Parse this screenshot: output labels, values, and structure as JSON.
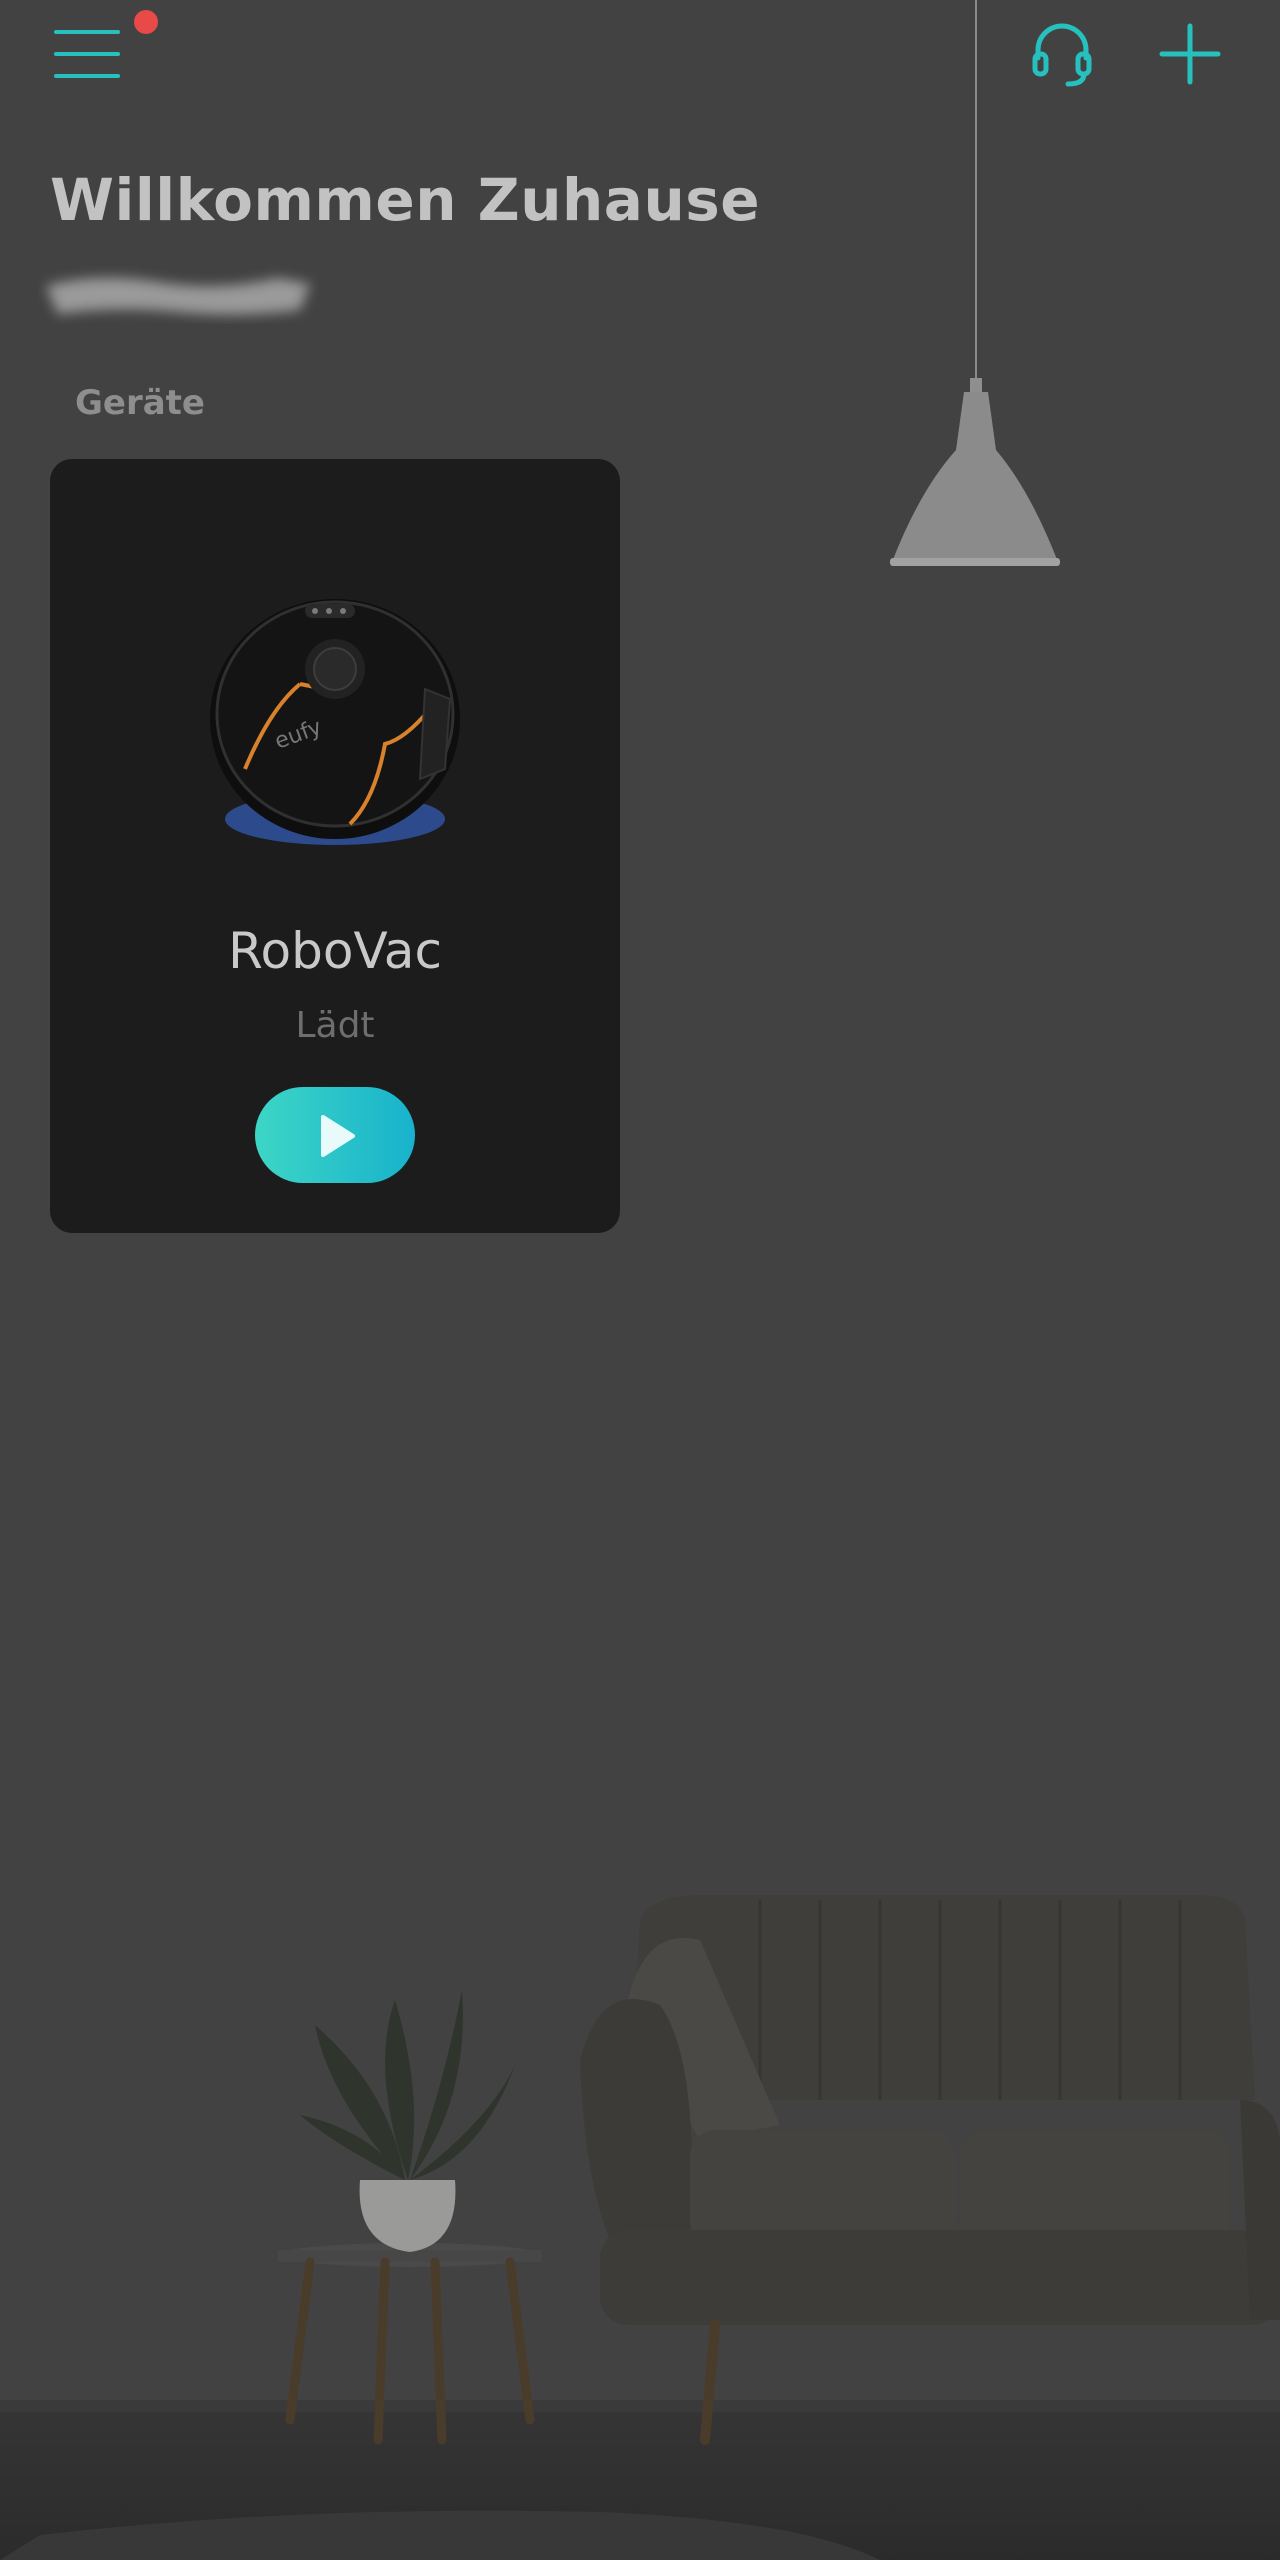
{
  "header": {
    "menu_icon": "hamburger-menu-icon",
    "notification_color": "#e84a4a",
    "support_icon": "headset-icon",
    "add_icon": "plus-icon",
    "accent_color": "#26c1bf"
  },
  "home": {
    "welcome_title": "Willkommen Zuhause",
    "section_label": "Geräte"
  },
  "devices": [
    {
      "name": "RoboVac",
      "status": "Lädt",
      "image_icon": "robot-vacuum-image",
      "brand_mark": "eufy",
      "action_icon": "play-icon"
    }
  ]
}
